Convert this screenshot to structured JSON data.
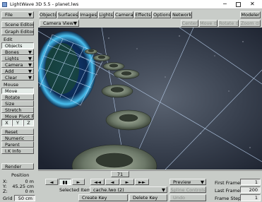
{
  "window": {
    "title": "LightWave 3D 5.5 - planet.lws"
  },
  "file_button": "File",
  "top_tabs": [
    "Objects",
    "Surfaces",
    "Images",
    "Lights",
    "Camera",
    "Effects",
    "Options",
    "Network"
  ],
  "modeler_button": "Modeler",
  "viewport": {
    "view_select": "Camera View",
    "controls": [
      "Center",
      "Move",
      "Rotate",
      "Zoom"
    ]
  },
  "sidebar": {
    "scene_editor": "Scene Editor",
    "graph_editor": "Graph Editor",
    "edit_header": "Edit",
    "edit_items": [
      "Objects",
      "Bones",
      "Lights",
      "Camera"
    ],
    "add": "Add",
    "clear": "Clear",
    "mouse_header": "Mouse",
    "mouse_items": [
      "Move",
      "Rotate",
      "Size",
      "Stretch",
      "Move Pivot Pt"
    ],
    "axes": [
      "X",
      "Y",
      "Z"
    ],
    "reset": "Reset",
    "numeric": "Numeric",
    "parent": "Parent",
    "ik_info": "I.K Info",
    "render": "Render",
    "position_header": "Position",
    "position": [
      {
        "axis": "X:",
        "value": "0 m"
      },
      {
        "axis": "Y:",
        "value": "45.25 cm"
      },
      {
        "axis": "Z:",
        "value": "0 m"
      }
    ],
    "grid_label": "Grid",
    "grid_value": "50 cm"
  },
  "timeline": {
    "frame_label": "71",
    "frame_fraction": 0.355,
    "transport": [
      "◄",
      "▮▮",
      "►",
      "◄◄",
      "◄",
      "►",
      "►►"
    ],
    "preview": "Preview",
    "selected_item_label": "Selected Item",
    "selected_item_value": "cache.lwo (2)",
    "spline_controls": "Spline Controls",
    "create_key": "Create Key",
    "delete_key": "Delete Key",
    "undo": "Undo",
    "first_frame_label": "First Frame",
    "first_frame": "1",
    "last_frame_label": "Last Frame",
    "last_frame": "200",
    "frame_step_label": "Frame Step",
    "frame_step": "1"
  },
  "colors": {
    "title_bar": "#ffffff",
    "panel": "#c8ccc8",
    "selected_button": "#e4ece8",
    "space": "#2a3140",
    "planet_glow": "#3fb4e6",
    "grid": "#c8e0ff"
  }
}
